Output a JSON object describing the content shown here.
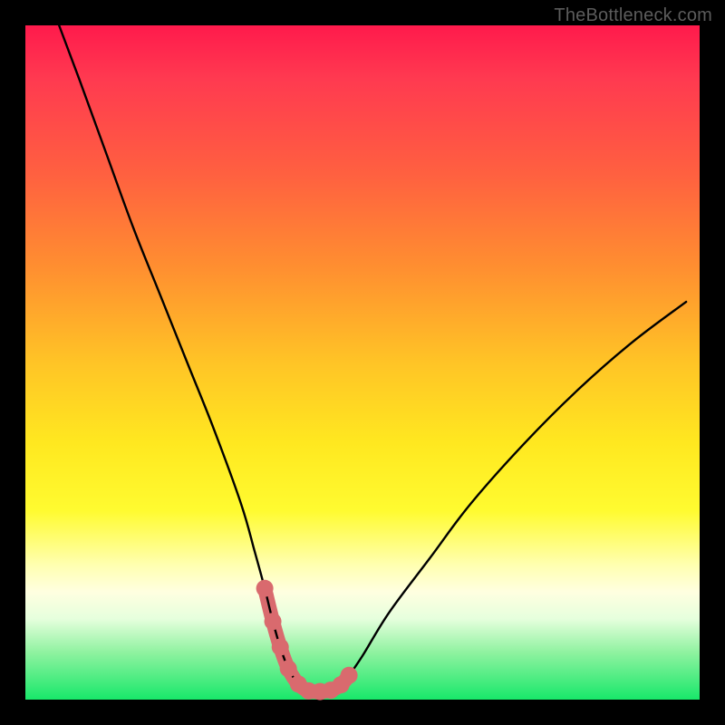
{
  "watermark": "TheBottleneck.com",
  "chart_data": {
    "type": "line",
    "title": "",
    "xlabel": "",
    "ylabel": "",
    "xlim": [
      0,
      100
    ],
    "ylim": [
      0,
      100
    ],
    "grid": false,
    "series": [
      {
        "name": "bottleneck-curve",
        "color": "#000000",
        "x": [
          5,
          8,
          12,
          16,
          20,
          24,
          28,
          32,
          34,
          35.5,
          36.7,
          37.8,
          39,
          40.5,
          42,
          43.7,
          45.3,
          46.8,
          48,
          50,
          54,
          60,
          66,
          74,
          82,
          90,
          98
        ],
        "y": [
          100,
          92,
          81,
          70,
          60,
          50,
          40,
          29,
          22,
          16.5,
          11.6,
          7.8,
          4.6,
          2.3,
          1.3,
          1.2,
          1.4,
          2.2,
          3.6,
          6.5,
          13,
          21,
          29,
          38,
          46,
          53,
          59
        ]
      },
      {
        "name": "bottom-marker-strip",
        "color": "#d96a6e",
        "x": [
          35.5,
          36.7,
          37.8,
          39,
          40.5,
          42,
          43.7,
          45.3,
          46.8,
          48
        ],
        "y": [
          16.5,
          11.6,
          7.8,
          4.6,
          2.3,
          1.3,
          1.2,
          1.4,
          2.2,
          3.6
        ]
      }
    ]
  },
  "colors": {
    "gradient_top": "#ff1a4c",
    "gradient_mid": "#ffe820",
    "gradient_bottom": "#18e86a",
    "curve": "#000000",
    "marker": "#d96a6e"
  }
}
